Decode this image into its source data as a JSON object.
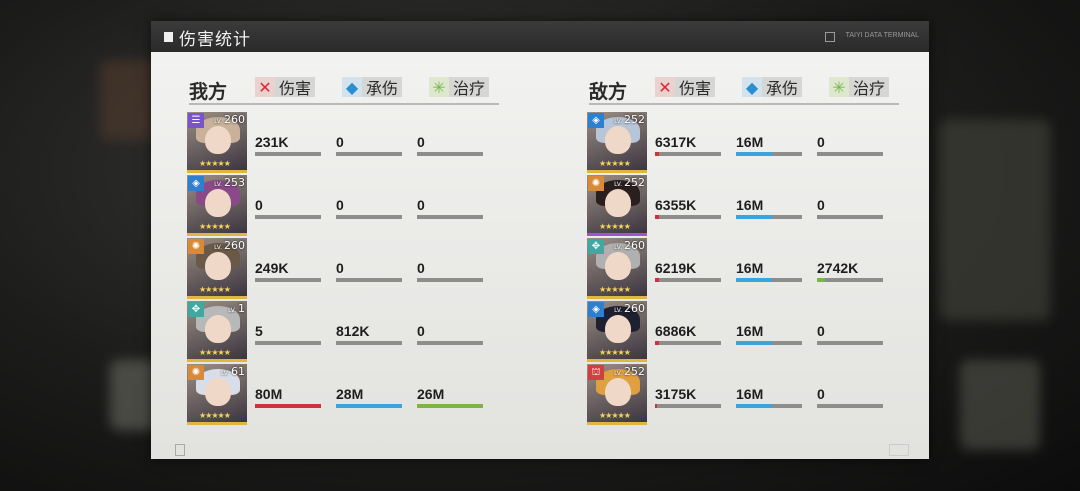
{
  "panel": {
    "title": "伤害统计",
    "terminal": "TAIYI DATA TERMINAL"
  },
  "headers": {
    "damage": "伤害",
    "tank": "承伤",
    "heal": "治疗"
  },
  "colors": {
    "damage": "#d4303c",
    "tank": "#3aa5dc",
    "heal": "#7cb446",
    "neutral_bar": "#8d8d8b"
  },
  "ally": {
    "label": "我方",
    "units": [
      {
        "level": "260",
        "class_icon": "attack-icon",
        "damage": "231K",
        "tank": "0",
        "heal": "0",
        "hair": "#c9b19a",
        "badge": "#7c54c9",
        "frame": "#e0b640"
      },
      {
        "level": "253",
        "class_icon": "shield-icon",
        "damage": "0",
        "tank": "0",
        "heal": "0",
        "hair": "#8a4a8a",
        "badge": "#2f7fd0",
        "frame": "#e0b640"
      },
      {
        "level": "260",
        "class_icon": "burst-icon",
        "damage": "249K",
        "tank": "0",
        "heal": "0",
        "hair": "#6a5848",
        "badge": "#d98a38",
        "frame": "#e0b640"
      },
      {
        "level": "1",
        "class_icon": "support-icon",
        "damage": "5",
        "tank": "812K",
        "heal": "0",
        "hair": "#b8b8b8",
        "badge": "#3fa8a0",
        "frame": "#e0b640"
      },
      {
        "level": "61",
        "class_icon": "burst-icon",
        "damage": "80M",
        "tank": "28M",
        "heal": "26M",
        "hair": "#d8dde8",
        "badge": "#d98a38",
        "frame": "#e0b640"
      }
    ],
    "bar_colors": [
      [
        "neutral",
        "neutral",
        "neutral"
      ],
      [
        "neutral",
        "neutral",
        "neutral"
      ],
      [
        "neutral",
        "neutral",
        "neutral"
      ],
      [
        "neutral",
        "neutral",
        "neutral"
      ],
      [
        "red",
        "blue",
        "green"
      ]
    ]
  },
  "enemy": {
    "label": "敌方",
    "units": [
      {
        "level": "252",
        "class_icon": "shield-icon",
        "damage": "6317K",
        "tank": "16M",
        "heal": "0",
        "hair": "#b8c4d8",
        "badge": "#2f7fd0",
        "frame": "#e0b640"
      },
      {
        "level": "252",
        "class_icon": "burst-icon",
        "damage": "6355K",
        "tank": "16M",
        "heal": "0",
        "hair": "#2a1e1e",
        "badge": "#d98a38",
        "frame": "#9b55d0"
      },
      {
        "level": "260",
        "class_icon": "support-icon",
        "damage": "6219K",
        "tank": "16M",
        "heal": "2742K",
        "hair": "#b0b0b0",
        "badge": "#3fa8a0",
        "frame": "#e0b640"
      },
      {
        "level": "260",
        "class_icon": "shield-icon",
        "damage": "6886K",
        "tank": "16M",
        "heal": "0",
        "hair": "#1e2030",
        "badge": "#2f7fd0",
        "frame": "#e0b640"
      },
      {
        "level": "252",
        "class_icon": "tower-icon",
        "damage": "3175K",
        "tank": "16M",
        "heal": "0",
        "hair": "#e0a040",
        "badge": "#d04040",
        "frame": "#e0b640"
      }
    ],
    "bar_fill": [
      {
        "damage": 0.06,
        "tank": 0.55,
        "heal": 0
      },
      {
        "damage": 0.06,
        "tank": 0.55,
        "heal": 0
      },
      {
        "damage": 0.06,
        "tank": 0.55,
        "heal": 0.12
      },
      {
        "damage": 0.06,
        "tank": 0.55,
        "heal": 0
      },
      {
        "damage": 0.03,
        "tank": 0.55,
        "heal": 0
      }
    ]
  },
  "stars": "★★★★★"
}
